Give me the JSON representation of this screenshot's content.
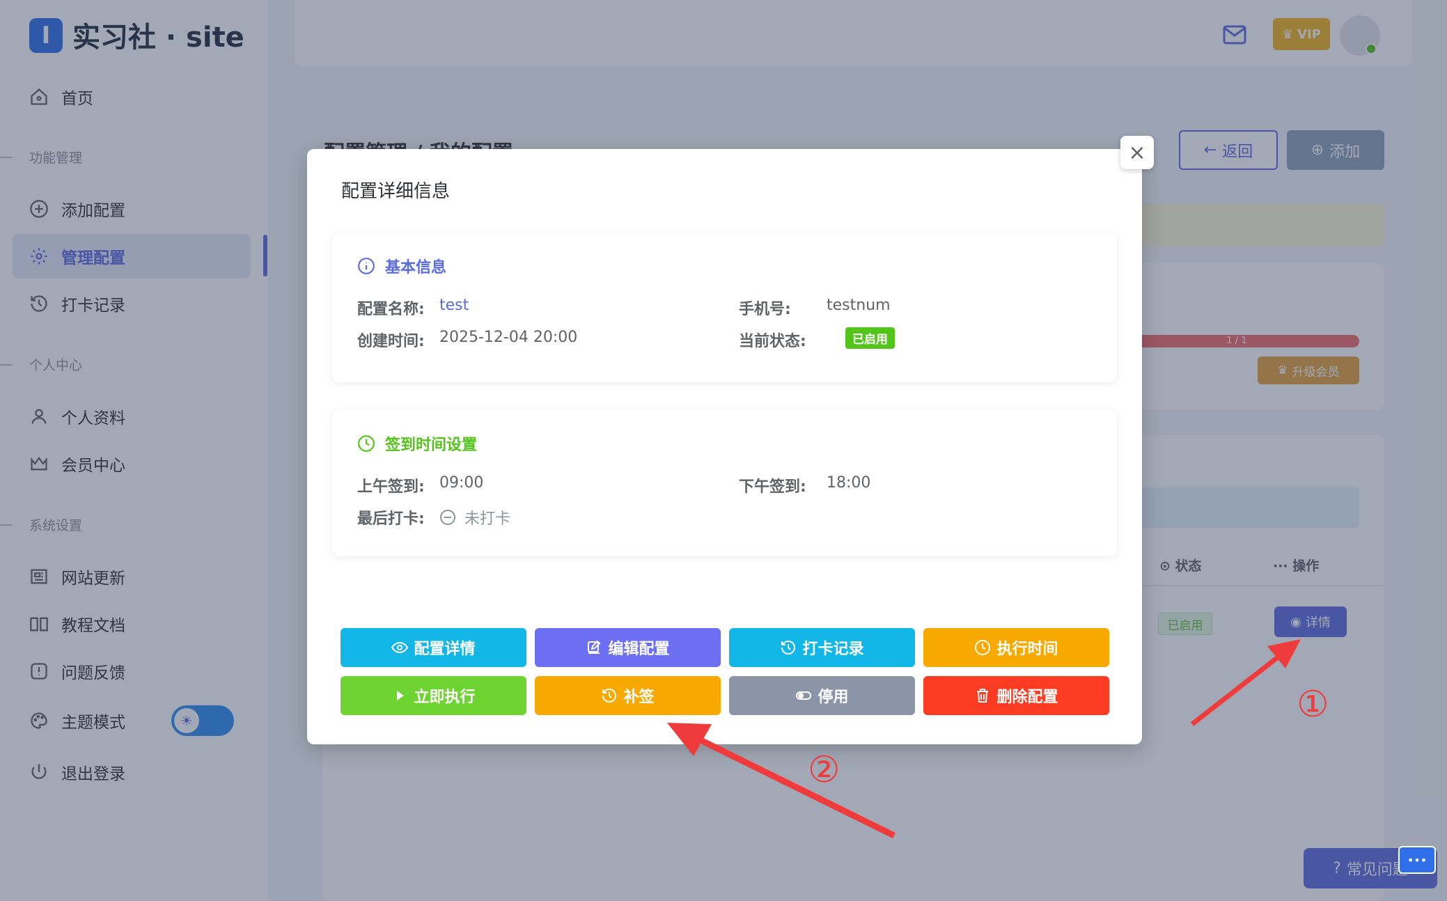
{
  "app": {
    "logo_letter": "I",
    "logo_text": "实习社 · site"
  },
  "sidebar": {
    "home": "首页",
    "section_func": "功能管理",
    "add_config": "添加配置",
    "manage_config": "管理配置",
    "checkin_records": "打卡记录",
    "section_personal": "个人中心",
    "profile": "个人资料",
    "member_center": "会员中心",
    "section_system": "系统设置",
    "site_updates": "网站更新",
    "tutorials": "教程文档",
    "feedback": "问题反馈",
    "theme_mode": "主题模式",
    "logout": "退出登录"
  },
  "header": {
    "vip_label": "VIP"
  },
  "background": {
    "page_title": "配置管理 / 我的配置",
    "back_button": "返回",
    "add_button": "添加",
    "progress_text": "1 / 1",
    "upgrade_button": "升级会员",
    "col_status": "状态",
    "col_ops": "操作",
    "row_status": "已启用",
    "row_detail_button": "详情",
    "faq_button": "常见问题",
    "chat_icon_text": "•••"
  },
  "modal": {
    "title": "配置详细信息",
    "close": "×",
    "basic": {
      "header": "基本信息",
      "name_label": "配置名称:",
      "name_value": "test",
      "phone_label": "手机号:",
      "phone_value": "testnum",
      "created_label": "创建时间:",
      "created_value": "2025-12-04 20:00",
      "status_label": "当前状态:",
      "status_value": "已启用"
    },
    "schedule": {
      "header": "签到时间设置",
      "am_label": "上午签到:",
      "am_value": "09:00",
      "pm_label": "下午签到:",
      "pm_value": "18:00",
      "last_label": "最后打卡:",
      "last_value": "未打卡"
    },
    "actions": {
      "detail": "配置详情",
      "edit": "编辑配置",
      "records": "打卡记录",
      "exec_time": "执行时间",
      "run_now": "立即执行",
      "makeup": "补签",
      "disable": "停用",
      "delete": "删除配置"
    }
  },
  "annotations": {
    "one": "①",
    "two": "②"
  },
  "colors": {
    "primary": "#5b6be1",
    "success": "#52c41a",
    "arrow": "#ef3b3b"
  }
}
